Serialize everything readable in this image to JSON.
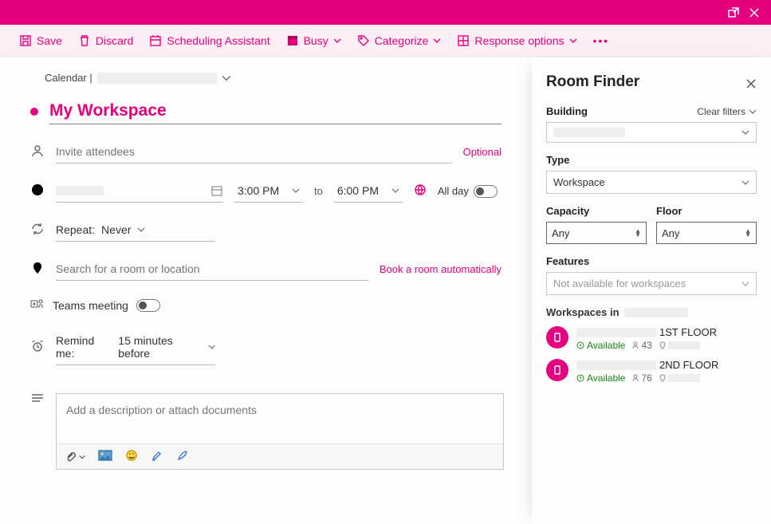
{
  "toolbar": {
    "save": "Save",
    "discard": "Discard",
    "scheduling": "Scheduling Assistant",
    "busy": "Busy",
    "categorize": "Categorize",
    "response": "Response options"
  },
  "composer": {
    "calendar_prefix": "Calendar |",
    "title": "My Workspace",
    "invite_placeholder": "Invite attendees",
    "optional": "Optional",
    "start_time": "3:00 PM",
    "to": "to",
    "end_time": "6:00 PM",
    "all_day": "All day",
    "repeat_label": "Repeat:",
    "repeat_value": "Never",
    "location_placeholder": "Search for a room or location",
    "book_auto": "Book a room automatically",
    "teams": "Teams meeting",
    "remind_label": "Remind me:",
    "remind_value": "15 minutes before",
    "desc_placeholder": "Add a description or attach documents"
  },
  "finder": {
    "title": "Room Finder",
    "building_label": "Building",
    "clear": "Clear filters",
    "type_label": "Type",
    "type_value": "Workspace",
    "capacity_label": "Capacity",
    "capacity_value": "Any",
    "floor_label": "Floor",
    "floor_value": "Any",
    "features_label": "Features",
    "features_value": "Not available for workspaces",
    "ws_header_prefix": "Workspaces in",
    "items": [
      {
        "name_suffix": "1ST FLOOR",
        "available": "Available",
        "capacity": "43"
      },
      {
        "name_suffix": "2ND FLOOR",
        "available": "Available",
        "capacity": "76"
      }
    ]
  }
}
